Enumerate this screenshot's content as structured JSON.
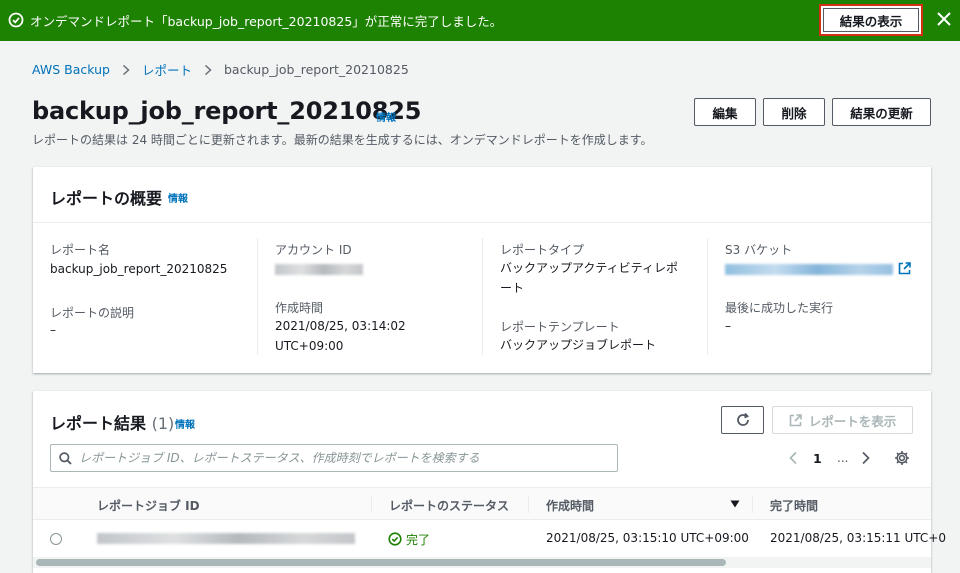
{
  "flash": {
    "message": "オンデマンドレポート「backup_job_report_20210825」が正常に完了しました。",
    "view_results_label": "結果の表示",
    "icons": {
      "status": "success-check-icon",
      "dismiss": "close-icon"
    },
    "color": "#1d8102"
  },
  "breadcrumb": {
    "items": [
      "AWS Backup",
      "レポート",
      "backup_job_report_20210825"
    ]
  },
  "header": {
    "title": "backup_job_report_20210825",
    "info_label": "情報",
    "description": "レポートの結果は 24 時間ごとに更新されます。最新の結果を生成するには、オンデマンドレポートを作成します。",
    "buttons": {
      "edit": "編集",
      "delete": "削除",
      "refresh_results": "結果の更新"
    }
  },
  "overview": {
    "title": "レポートの概要",
    "info_label": "情報",
    "report_name_label": "レポート名",
    "report_name_value": "backup_job_report_20210825",
    "report_desc_label": "レポートの説明",
    "report_desc_value": "–",
    "account_id_label": "アカウント ID",
    "created_label": "作成時間",
    "created_value_line1": "2021/08/25, 03:14:02",
    "created_value_line2": "UTC+09:00",
    "report_type_label": "レポートタイプ",
    "report_type_value_line1": "バックアップアクティビティレポ",
    "report_type_value_line2": "ート",
    "template_label": "レポートテンプレート",
    "template_value": "バックアップジョブレポート",
    "s3_label": "S3 バケット",
    "last_success_label": "最後に成功した実行",
    "last_success_value": "–"
  },
  "results": {
    "title": "レポート結果",
    "count": "(1)",
    "info_label": "情報",
    "view_report_label": "レポートを表示",
    "search_placeholder": "レポートジョブ ID、レポートステータス、作成時刻でレポートを検索する",
    "pagination": {
      "current_page": "1",
      "ellipsis": "..."
    },
    "columns": [
      "レポートジョブ ID",
      "レポートのステータス",
      "作成時間",
      "完了時間"
    ],
    "rows": [
      {
        "status": "完了",
        "created": "2021/08/25, 03:15:10 UTC+09:00",
        "completed": "2021/08/25, 03:15:11 UTC+0"
      }
    ],
    "status_color": "#1d8102"
  }
}
